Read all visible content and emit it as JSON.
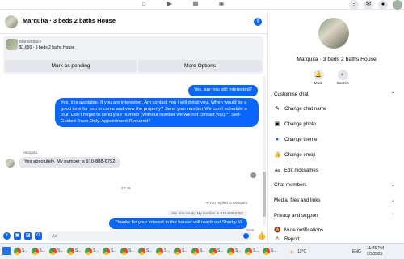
{
  "chat": {
    "title": "Marquita · 3 beds 2 baths House",
    "marketplace": {
      "label": "Marketplace",
      "listing": "$1,650 - 3 beds 2 baths House",
      "mark_pending": "Mark as pending",
      "more_options": "More Options"
    },
    "messages": {
      "m1": "Yes, are you still interested?",
      "m2": "Yes, it is available. If you are interested. Am contact you I will detail you. When would be a good time for you to come and view the property? Send your number We can I schedule a tour. Don't forget to send your number (Without number we will not contact you).** Self-Guided Tours Only. Appointment Required /",
      "sender_name": "Marquita",
      "m3": "Yes absolutely. My number is 910-888-6792",
      "time_divider": "23:48",
      "replied_note": "You replied to Marquita",
      "quoted": "Yes absolutely. My number is 910-888-6792",
      "m4": "Thanks for your interest in the house! will reach out Shortly ///",
      "status": "Sent"
    },
    "composer_placeholder": "Aa"
  },
  "sidebar": {
    "name": "Marquita · 3 beds 2 baths House",
    "mute": "Mute",
    "search": "Search",
    "customise": "Customise chat",
    "items": [
      "Change chat name",
      "Change photo",
      "Change theme",
      "Change emoji",
      "Edit nicknames"
    ],
    "chat_members": "Chat members",
    "media": "Media, files and links",
    "privacy": "Privacy and support",
    "mute_notifications": "Mute notifications",
    "report": "Report"
  },
  "taskbar": {
    "items": [
      "S...",
      "5...",
      "S...",
      "S...",
      "S...",
      "S...",
      "S...",
      "S...",
      "S...",
      "S...",
      "S...",
      "S...",
      "S...",
      "S...",
      "S..."
    ],
    "weather": "13°C",
    "lang": "ENG",
    "time": "11:45 PM",
    "date": "2/3/2025"
  },
  "colors": {
    "accent": "#0866ff",
    "bubble_in": "#e4e6eb"
  }
}
